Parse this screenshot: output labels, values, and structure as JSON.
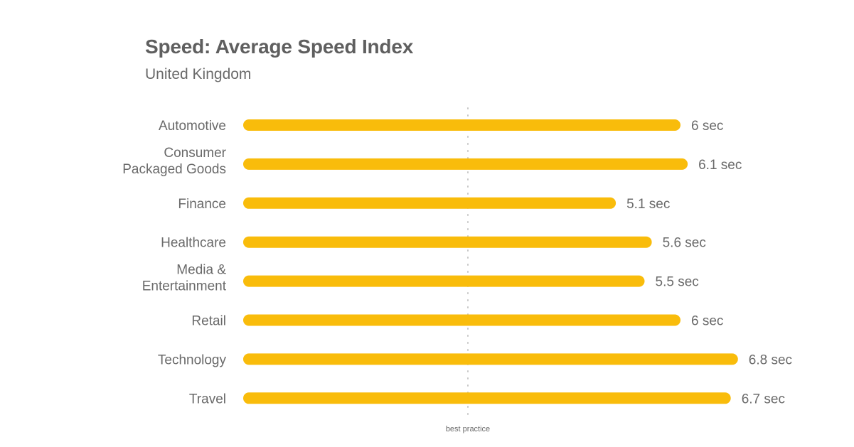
{
  "chart_data": {
    "type": "bar",
    "orientation": "horizontal",
    "title": "Speed: Average Speed Index",
    "subtitle": "United Kingdom",
    "categories": [
      [
        "Automotive"
      ],
      [
        "Consumer",
        "Packaged Goods"
      ],
      [
        "Finance"
      ],
      [
        "Healthcare"
      ],
      [
        "Media &",
        "Entertainment"
      ],
      [
        "Retail"
      ],
      [
        "Technology"
      ],
      [
        "Travel"
      ]
    ],
    "values": [
      6,
      6.1,
      5.1,
      5.6,
      5.5,
      6,
      6.8,
      6.7
    ],
    "value_labels": [
      "6 sec",
      "6.1 sec",
      "5.1 sec",
      "5.6 sec",
      "5.5 sec",
      "6 sec",
      "6.8 sec",
      "6.7 sec"
    ],
    "unit": "sec",
    "xlim": [
      0,
      7
    ],
    "reference_line": {
      "value": 3,
      "label": "best practice",
      "style": "dotted"
    },
    "bar_color": "#f9bc0b",
    "grid": false,
    "legend": "none"
  }
}
